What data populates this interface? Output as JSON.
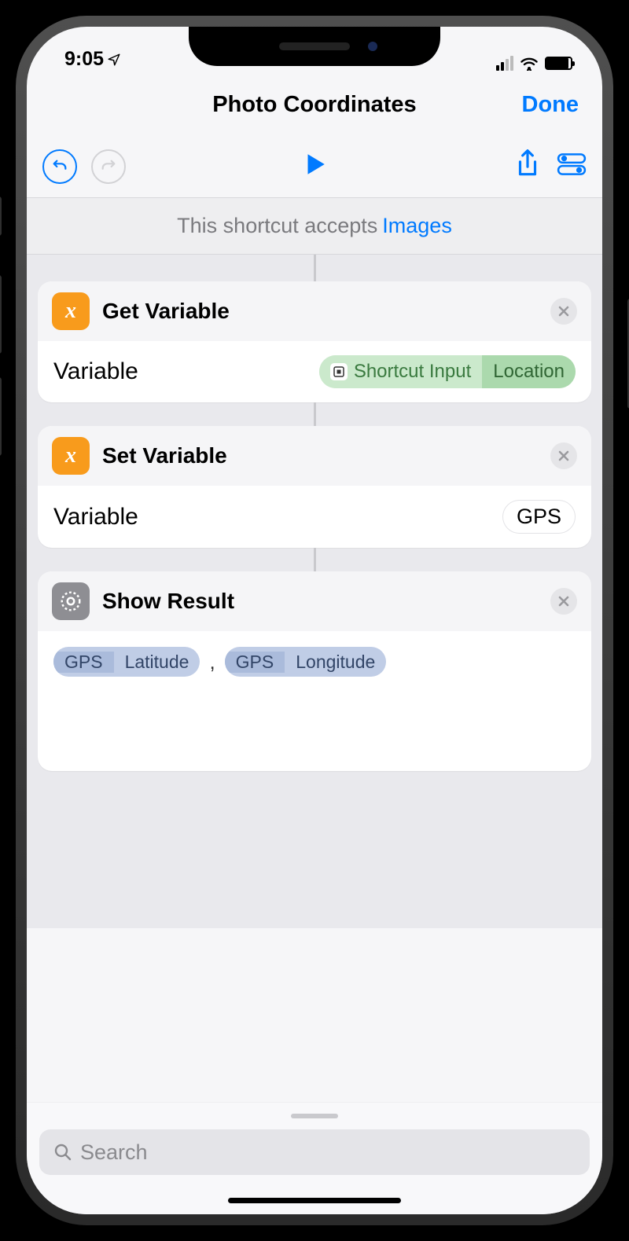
{
  "status": {
    "time": "9:05"
  },
  "nav": {
    "title": "Photo Coordinates",
    "done": "Done"
  },
  "accepts": {
    "prefix": "This shortcut accepts",
    "type": "Images"
  },
  "actions": {
    "a1": {
      "title": "Get Variable",
      "param_label": "Variable",
      "pill_main": "Shortcut Input",
      "pill_sub": "Location"
    },
    "a2": {
      "title": "Set Variable",
      "param_label": "Variable",
      "value": "GPS"
    },
    "a3": {
      "title": "Show Result",
      "token1_main": "GPS",
      "token1_sub": "Latitude",
      "token2_main": "GPS",
      "token2_sub": "Longitude",
      "sep": ","
    }
  },
  "search": {
    "placeholder": "Search"
  }
}
